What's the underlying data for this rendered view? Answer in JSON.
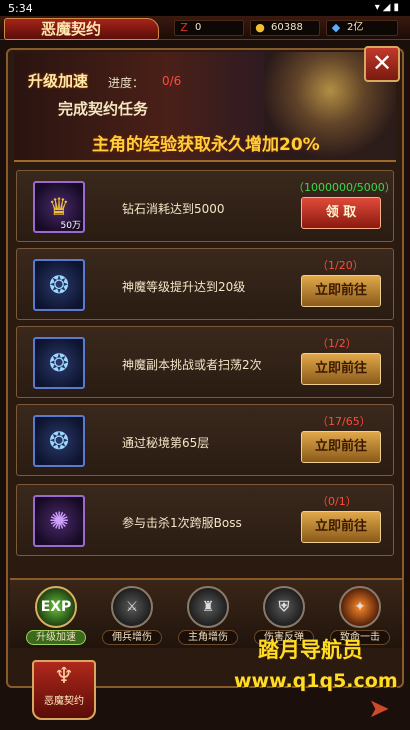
{
  "status_bar": {
    "time": "5:34",
    "icons": "▾◢▮"
  },
  "header": {
    "title": "恶魔契约",
    "resources": [
      {
        "icon": "ruby-icon",
        "value": "0"
      },
      {
        "icon": "gold-icon",
        "value": "60388"
      },
      {
        "icon": "diamond-icon",
        "value": "2亿"
      }
    ]
  },
  "banner": {
    "tag": "升级加速",
    "progress_label": "进度：",
    "progress_value": "0/6",
    "subtitle": "完成契约任务",
    "headline": "主角的经验获取永久增加20%"
  },
  "tasks": [
    {
      "desc": "钻石消耗达到5000",
      "count": "（1000000/5000）",
      "action": "领 取",
      "reward_qty": "50万",
      "icon": "gold-ingot-icon"
    },
    {
      "desc": "神魔等级提升达到20级",
      "count": "（1/20）",
      "action": "立即前往",
      "icon": "blue-swirl-icon"
    },
    {
      "desc": "神魔副本挑战或者扫荡2次",
      "count": "（1/2）",
      "action": "立即前往",
      "icon": "blue-swirl-icon"
    },
    {
      "desc": "通过秘境第65层",
      "count": "（17/65）",
      "action": "立即前往",
      "icon": "blue-swirl-icon"
    },
    {
      "desc": "参与击杀1次跨服Boss",
      "count": "（0/1）",
      "action": "立即前往",
      "icon": "purple-orb-icon"
    }
  ],
  "tabs": [
    {
      "label": "升级加速",
      "glyph": "EXP",
      "active": true
    },
    {
      "label": "佣兵增伤",
      "glyph": "⚔"
    },
    {
      "label": "主角增伤",
      "glyph": "♜"
    },
    {
      "label": "伤害反弹",
      "glyph": "⛨"
    },
    {
      "label": "致命一击",
      "glyph": "✦"
    }
  ],
  "bottom_emblem": {
    "label": "恶魔契约"
  },
  "watermark": {
    "line1": "踏月导航员",
    "line2": "www.q1q5.com"
  }
}
